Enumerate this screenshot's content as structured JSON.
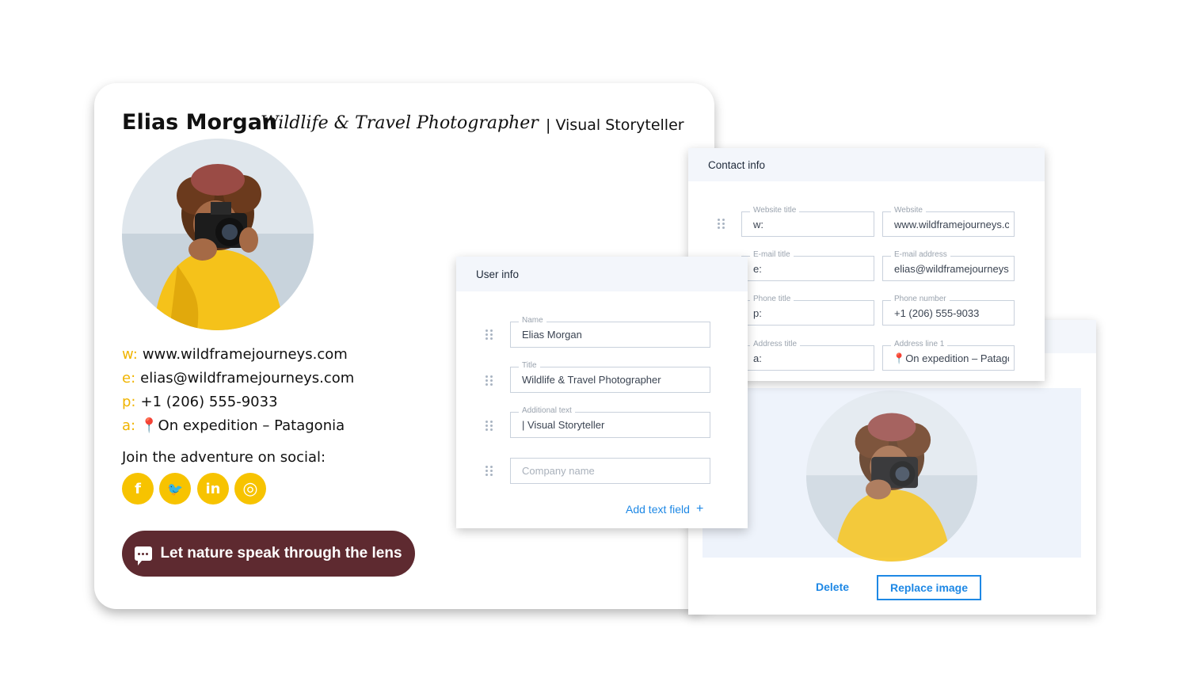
{
  "signature": {
    "name": "Elias Morgan",
    "title": "Wildlife & Travel Photographer",
    "additional": "| Visual Storyteller",
    "contacts": [
      {
        "label": "w:",
        "value": "www.wildframejourneys.com"
      },
      {
        "label": "e:",
        "value": "elias@wildframejourneys.com"
      },
      {
        "label": "p:",
        "value": "+1 (206) 555-9033"
      },
      {
        "label": "a:",
        "value": "On expedition – Patagonia"
      }
    ],
    "social_heading": "Join the adventure on social:",
    "social": [
      {
        "name": "facebook-icon",
        "glyph": "f"
      },
      {
        "name": "twitter-icon",
        "glyph": "🐦"
      },
      {
        "name": "linkedin-icon",
        "glyph": "in"
      },
      {
        "name": "instagram-icon",
        "glyph": "◎"
      }
    ],
    "cta_label": "Let nature speak through the lens",
    "colors": {
      "accent": "#f7c300",
      "cta": "#5e2a30"
    }
  },
  "user_info": {
    "header": "User info",
    "fields": [
      {
        "label": "Name",
        "value": "Elias Morgan"
      },
      {
        "label": "Title",
        "value": "Wildlife & Travel Photographer"
      },
      {
        "label": "Additional text",
        "value": "| Visual Storyteller"
      },
      {
        "label": "",
        "placeholder": "Company name",
        "value": ""
      }
    ],
    "add_field": "Add text field"
  },
  "contact_info": {
    "header": "Contact info",
    "rows": [
      {
        "title_label": "Website title",
        "title_value": "w:",
        "value_label": "Website",
        "value": "www.wildframejourneys.com"
      },
      {
        "title_label": "E-mail title",
        "title_value": "e:",
        "value_label": "E-mail address",
        "value": "elias@wildframejourneys.com"
      },
      {
        "title_label": "Phone title",
        "title_value": "p:",
        "value_label": "Phone number",
        "value": "+1 (206) 555-9033"
      },
      {
        "title_label": "Address title",
        "title_value": "a:",
        "value_label": "Address line 1",
        "value": "On expedition – Patagonia"
      }
    ]
  },
  "image_panel": {
    "delete_label": "Delete",
    "replace_label": "Replace image"
  }
}
